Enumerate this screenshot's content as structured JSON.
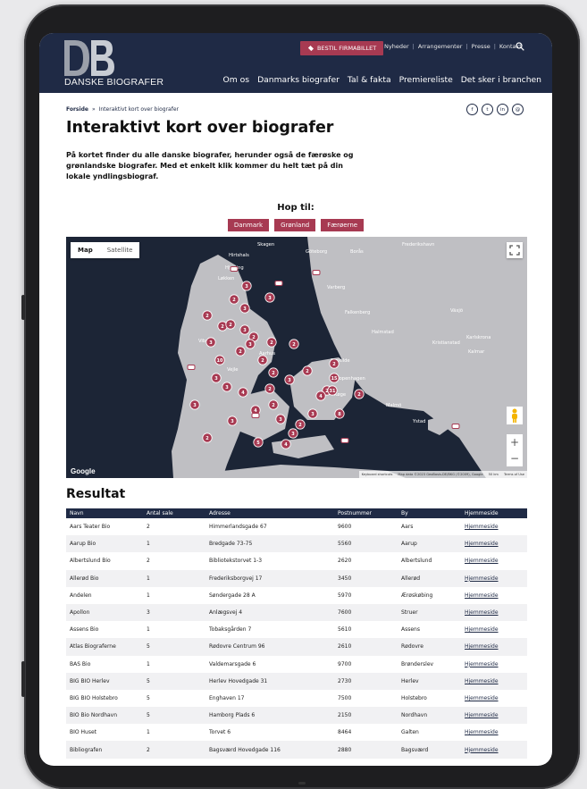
{
  "header": {
    "logo_text": "DANSKE BIOGRAFER",
    "cta_label": "BESTIL FIRMABILLET",
    "utility_links": [
      "Nyheder",
      "Arrangementer",
      "Presse",
      "Kontakt"
    ],
    "nav": [
      "Om os",
      "Danmarks biografer",
      "Tal & fakta",
      "Premiereliste",
      "Det sker i branchen"
    ]
  },
  "breadcrumb": {
    "home": "Forside",
    "separator": "»",
    "current": "Interaktivt kort over biografer"
  },
  "share_icons": [
    "f",
    "t",
    "in",
    "@"
  ],
  "page": {
    "title": "Interaktivt kort over biografer",
    "intro": "På kortet finder du alle danske biografer, herunder også de færøske og grønlandske biografer. Med et enkelt klik kommer du helt tæt på din lokale yndlingsbiograf."
  },
  "jump": {
    "title": "Hop til:",
    "buttons": [
      "Danmark",
      "Grønland",
      "Færøerne"
    ]
  },
  "map": {
    "type_map": "Map",
    "type_satellite": "Satellite",
    "google": "Google",
    "zoom_in": "+",
    "zoom_out": "−",
    "attribution": [
      "Keyboard shortcuts",
      "Map data ©2023 GeoBasis-DE/BKG (©2009), Google",
      "50 km",
      "Terms of Use"
    ],
    "places": [
      "Göteborg",
      "Borås",
      "Växjö",
      "Karlskrona",
      "Malmö",
      "Ystad",
      "Hirtshals",
      "Viborg",
      "Kalmar",
      "Kristianstad",
      "Halmstad",
      "Frederikshavn",
      "Hjørring",
      "Løkken",
      "Falkenberg",
      "Varberg",
      "Skagen",
      "Aarhus",
      "Vejle",
      "Roskilde",
      "Køge",
      "Copenhagen"
    ],
    "cluster_counts": [
      "3",
      "3",
      "3",
      "2",
      "2",
      "3",
      "2",
      "3",
      "10",
      "2",
      "2",
      "2",
      "3",
      "3",
      "3",
      "2",
      "2",
      "4",
      "3",
      "3",
      "2",
      "3",
      "8",
      "2",
      "2",
      "15",
      "31",
      "4",
      "2",
      "3",
      "2",
      "5",
      "4",
      "2",
      "2",
      "4",
      "3",
      "2",
      "2",
      "2",
      "3"
    ]
  },
  "results": {
    "title": "Resultat",
    "columns": [
      "Navn",
      "Antal sale",
      "Adresse",
      "Postnummer",
      "By",
      "Hjemmeside"
    ],
    "rows": [
      [
        "Aars Teater Bio",
        "2",
        "Himmerlandsgade 67",
        "9600",
        "Aars",
        "Hjemmeside"
      ],
      [
        "Aarup Bio",
        "1",
        "Bredgade 73-75",
        "5560",
        "Aarup",
        "Hjemmeside"
      ],
      [
        "Albertslund Bio",
        "2",
        "Bibliotekstorvet 1-3",
        "2620",
        "Albertslund",
        "Hjemmeside"
      ],
      [
        "Allerød Bio",
        "1",
        "Frederiksborgvej 17",
        "3450",
        "Allerød",
        "Hjemmeside"
      ],
      [
        "Andelen",
        "1",
        "Søndergade 28 A",
        "5970",
        "Ærøskøbing",
        "Hjemmeside"
      ],
      [
        "Apollon",
        "3",
        "Anlægsvej 4",
        "7600",
        "Struer",
        "Hjemmeside"
      ],
      [
        "Assens Bio",
        "1",
        "Tobaksgården 7",
        "5610",
        "Assens",
        "Hjemmeside"
      ],
      [
        "Atlas Biograferne",
        "5",
        "Rødovre Centrum 96",
        "2610",
        "Rødovre",
        "Hjemmeside"
      ],
      [
        "BAS Bio",
        "1",
        "Valdemarsgade 6",
        "9700",
        "Brønderslev",
        "Hjemmeside"
      ],
      [
        "BIG BIO Herlev",
        "5",
        "Herlev Hovedgade 31",
        "2730",
        "Herlev",
        "Hjemmeside"
      ],
      [
        "BIG BIO Holstebro",
        "5",
        "Enghaven 17",
        "7500",
        "Holstebro",
        "Hjemmeside"
      ],
      [
        "BIO Bio Nordhavn",
        "5",
        "Hamborg Plads 6",
        "2150",
        "Nordhavn",
        "Hjemmeside"
      ],
      [
        "BIO Huset",
        "1",
        "Torvet 6",
        "8464",
        "Galten",
        "Hjemmeside"
      ],
      [
        "Bibliografen",
        "2",
        "Bagsværd Hovedgade 116",
        "2880",
        "Bagsværd",
        "Hjemmeside"
      ]
    ]
  }
}
